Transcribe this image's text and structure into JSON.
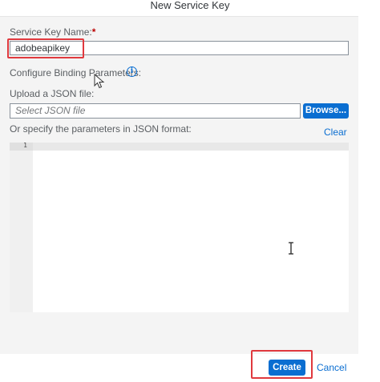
{
  "dialog": {
    "title": "New Service Key"
  },
  "form": {
    "service_key_label": "Service Key Name:",
    "required_marker": "*",
    "service_key_value": "adobeapikey",
    "binding_params_label": "Configure Binding Parameters:",
    "info_icon_glyph": "i",
    "upload_label": "Upload a JSON file:",
    "file_placeholder": "Select JSON file",
    "browse_label": "Browse...",
    "json_params_label": "Or specify the parameters in JSON format:",
    "clear_label": "Clear"
  },
  "editor": {
    "line_numbers": [
      "1"
    ]
  },
  "footer": {
    "create_label": "Create",
    "cancel_label": "Cancel"
  },
  "colors": {
    "accent": "#0a6ed1",
    "highlight": "#e0393e",
    "required": "#bb0000"
  },
  "icons": {
    "info": "info-icon",
    "pointer": "mouse-pointer-icon",
    "text_cursor": "text-cursor-icon"
  }
}
